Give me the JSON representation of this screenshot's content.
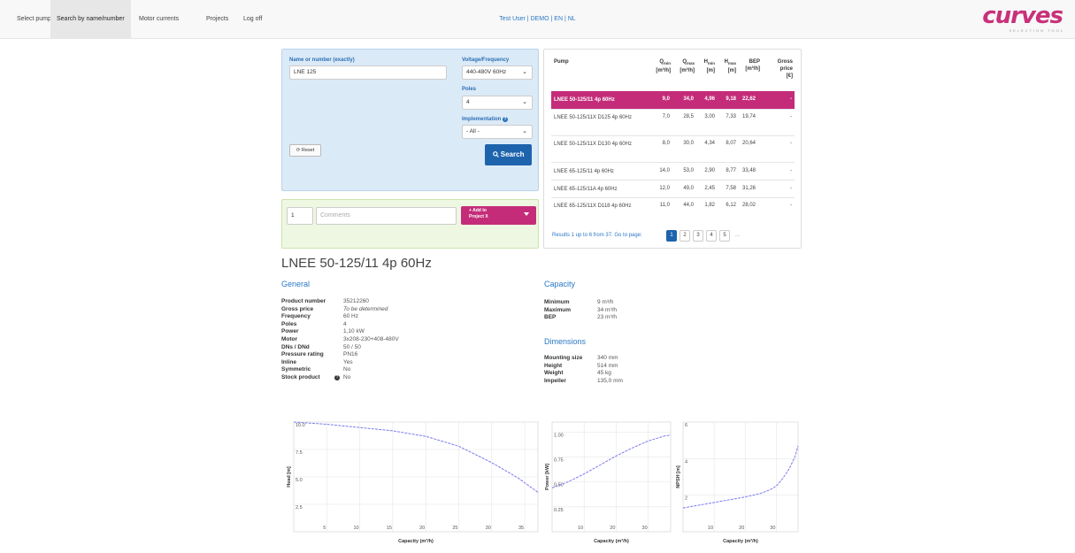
{
  "nav": {
    "items": [
      "Select pump",
      "Search by name/number",
      "Motor currents",
      "Projects",
      "Log off"
    ],
    "user_prefix": "Test User | ",
    "user_links": [
      "DEMO",
      "EN",
      "NL"
    ],
    "user_separator": " | "
  },
  "logo": {
    "text": "curves",
    "subtitle": "SELECTION TOOL"
  },
  "search": {
    "name_label": "Name or number (exactly)",
    "name_value": "LNE 125",
    "voltage_label": "Voltage/Frequency",
    "voltage_value": "440-480V 60Hz",
    "poles_label": "Poles",
    "poles_value": "4",
    "impl_label": "Implementation",
    "impl_value": "- All -",
    "reset_label": "Reset",
    "search_label": "Search"
  },
  "add": {
    "quantity": "1",
    "comments_placeholder": "Comments",
    "button_line1": "+ Add to",
    "button_line2": "Project X"
  },
  "results": {
    "headers": {
      "pump": "Pump",
      "qmin": [
        "Q",
        "min",
        "[m³/h]"
      ],
      "qmax": [
        "Q",
        "max",
        "[m³/h]"
      ],
      "hmin": [
        "H",
        "min",
        "[m]"
      ],
      "hmax": [
        "H",
        "max",
        "[m]"
      ],
      "bep": [
        "BEP",
        "[m³/h]"
      ],
      "gross": [
        "Gross",
        "price",
        "[€]"
      ]
    },
    "rows": [
      {
        "name": "LNEE 50-125/11 4p 60Hz",
        "qmin": "9,0",
        "qmax": "34,0",
        "hmin": "4,96",
        "hmax": "9,18",
        "bep": "22,62",
        "price": "-"
      },
      {
        "name": "LNEE 50-125/11X D125 4p 60Hz",
        "qmin": "7,0",
        "qmax": "28,5",
        "hmin": "3,00",
        "hmax": "7,33",
        "bep": "19,74",
        "price": "-"
      },
      {
        "name": "LNEE 50-125/11X D130 4p 60Hz",
        "qmin": "8,0",
        "qmax": "30,0",
        "hmin": "4,34",
        "hmax": "8,07",
        "bep": "20,64",
        "price": "-"
      },
      {
        "name": "LNEE 65-125/11 4p 60Hz",
        "qmin": "14,0",
        "qmax": "53,0",
        "hmin": "2,90",
        "hmax": "8,77",
        "bep": "33,48",
        "price": "-"
      },
      {
        "name": "LNEE 65-125/11A 4p 60Hz",
        "qmin": "12,0",
        "qmax": "49,0",
        "hmin": "2,45",
        "hmax": "7,58",
        "bep": "31,26",
        "price": "-"
      },
      {
        "name": "LNEE 65-125/11X D118 4p 60Hz",
        "qmin": "11,0",
        "qmax": "44,0",
        "hmin": "1,82",
        "hmax": "6,12",
        "bep": "28,02",
        "price": "-"
      }
    ],
    "summary": "Results 1 up to 6 from 37. Go to page:",
    "pages": [
      "1",
      "2",
      "3",
      "4",
      "5",
      "..."
    ]
  },
  "product": {
    "title": "LNEE 50-125/11 4p 60Hz",
    "general_title": "General",
    "general": [
      {
        "k": "Product number",
        "v": "35212260"
      },
      {
        "k": "Gross price",
        "v": "To be determined"
      },
      {
        "k": "Frequency",
        "v": "60 Hz"
      },
      {
        "k": "Poles",
        "v": "4"
      },
      {
        "k": "Power",
        "v": "1,10 kW"
      },
      {
        "k": "Motor",
        "v": "3x208-230+408-480V"
      },
      {
        "k": "DNs / DNd",
        "v": "50 / 50"
      },
      {
        "k": "Pressure rating",
        "v": "PN16"
      },
      {
        "k": "Inline",
        "v": "Yes"
      },
      {
        "k": "Symmetric",
        "v": "No"
      },
      {
        "k": "Stock product",
        "v": "No"
      }
    ],
    "capacity_title": "Capacity",
    "capacity": [
      {
        "k": "Minimum",
        "v": "9 m³/h"
      },
      {
        "k": "Maximum",
        "v": "34 m³/h"
      },
      {
        "k": "BEP",
        "v": "23 m³/h"
      }
    ],
    "dimensions_title": "Dimensions",
    "dimensions": [
      {
        "k": "Mounting size",
        "v": "340 mm"
      },
      {
        "k": "Height",
        "v": "514 mm"
      },
      {
        "k": "Weight",
        "v": "45 kg"
      },
      {
        "k": "Impeller",
        "v": "135,0 mm"
      }
    ]
  },
  "chart_data": [
    {
      "type": "line",
      "xlabel": "Capacity (m³/h)",
      "ylabel": "Head [m]",
      "xlim": [
        0,
        37
      ],
      "ylim": [
        0,
        10
      ],
      "xticks": [
        "5",
        "10",
        "15",
        "20",
        "25",
        "30",
        "35"
      ],
      "yticks": [
        "2.5",
        "5.0",
        "7.5",
        "10.0"
      ],
      "series": [
        {
          "name": "Head [m]",
          "color": "#7b7bee",
          "x": [
            0,
            5,
            10,
            15,
            20,
            25,
            30,
            34,
            37
          ],
          "y": [
            10.0,
            9.8,
            9.5,
            9.2,
            8.7,
            7.8,
            6.3,
            4.9,
            3.6
          ]
        }
      ],
      "grid": true
    },
    {
      "type": "line",
      "xlabel": "Capacity (m³/h)",
      "ylabel": "Power [kW]",
      "xlim": [
        0,
        37
      ],
      "ylim": [
        0,
        1.1
      ],
      "xticks": [
        "10",
        "20",
        "30"
      ],
      "yticks": [
        "0.25",
        "0.50",
        "0.75",
        "1.00"
      ],
      "series": [
        {
          "name": "Power",
          "color": "#7b7bee",
          "x": [
            0,
            5,
            10,
            15,
            20,
            25,
            30,
            35,
            37
          ],
          "y": [
            0.44,
            0.5,
            0.58,
            0.67,
            0.76,
            0.84,
            0.91,
            0.96,
            0.97
          ]
        }
      ],
      "grid": true
    },
    {
      "type": "line",
      "xlabel": "Capacity (m³/h)",
      "ylabel": "NPSH [m]",
      "xlim": [
        0,
        37
      ],
      "ylim": [
        0,
        6
      ],
      "xticks": [
        "10",
        "20",
        "30"
      ],
      "yticks": [
        "2",
        "4",
        "6"
      ],
      "series": [
        {
          "name": "NPSH",
          "color": "#7b7bee",
          "x": [
            0,
            5,
            10,
            15,
            20,
            25,
            28,
            30,
            32,
            34,
            36,
            37
          ],
          "y": [
            1.3,
            1.45,
            1.6,
            1.75,
            1.9,
            2.1,
            2.3,
            2.5,
            2.9,
            3.4,
            4.1,
            4.7
          ]
        }
      ],
      "grid": true
    }
  ]
}
